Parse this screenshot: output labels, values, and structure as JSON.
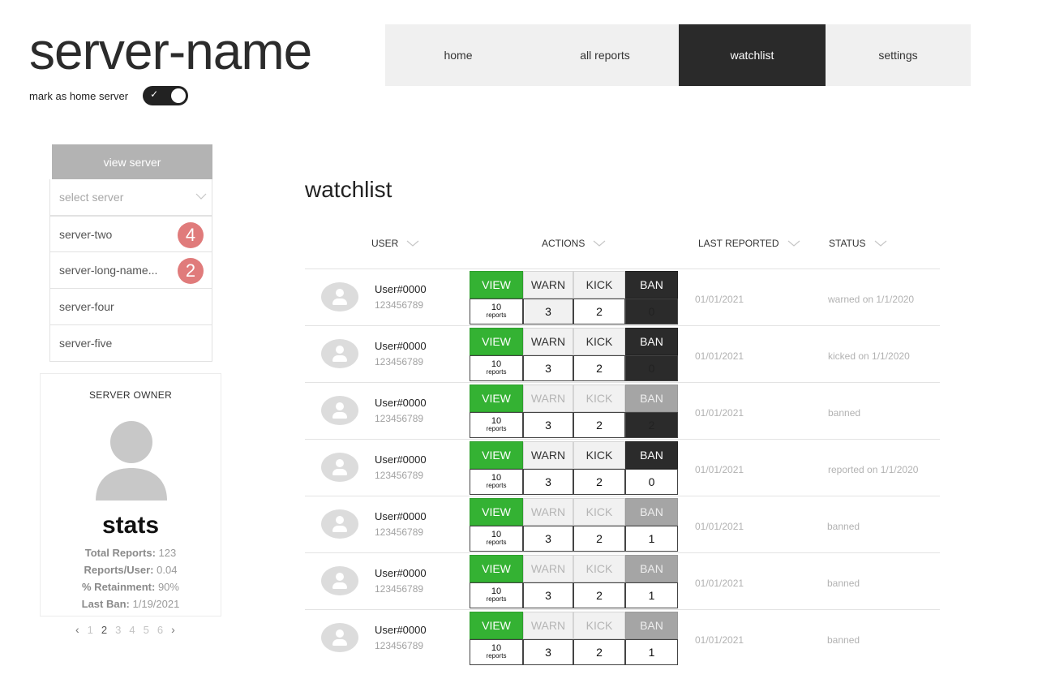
{
  "header": {
    "server_name": "server-name",
    "home_toggle_label": "mark as home server",
    "home_toggle_on": true
  },
  "nav": {
    "tabs": [
      {
        "label": "home",
        "active": false
      },
      {
        "label": "all reports",
        "active": false
      },
      {
        "label": "watchlist",
        "active": true
      },
      {
        "label": "settings",
        "active": false
      }
    ]
  },
  "sidebar": {
    "view_server_label": "view server",
    "select_placeholder": "select server",
    "servers": [
      {
        "name": "server-two",
        "badge": "4"
      },
      {
        "name": "server-long-name...",
        "badge": "2"
      },
      {
        "name": "server-four",
        "badge": ""
      },
      {
        "name": "server-five",
        "badge": ""
      }
    ],
    "owner_card": {
      "title": "SERVER OWNER",
      "stats_title": "stats",
      "stats": [
        {
          "label": "Total Reports:",
          "value": "123"
        },
        {
          "label": "Reports/User:",
          "value": "0.04"
        },
        {
          "label": "% Retainment:",
          "value": "90%"
        },
        {
          "label": "Last Ban:",
          "value": "1/19/2021"
        }
      ]
    },
    "pagination": {
      "prev": "‹",
      "next": "›",
      "pages": [
        "1",
        "2",
        "3",
        "4",
        "5",
        "6"
      ],
      "current": "2"
    }
  },
  "main": {
    "heading": "watchlist",
    "columns": [
      "USER",
      "ACTIONS",
      "LAST REPORTED",
      "STATUS"
    ],
    "action_labels": {
      "view": "VIEW",
      "warn": "WARN",
      "kick": "KICK",
      "ban": "BAN"
    },
    "reports_unit": "reports",
    "rows": [
      {
        "user": "User#0000",
        "id": "123456789",
        "reports": "10",
        "warns": "3",
        "kicks": "2",
        "bans": "0",
        "last_reported": "01/01/2021",
        "status": "warned on 1/1/2020",
        "muted": false,
        "ban_dark": true,
        "warn_shaded": true
      },
      {
        "user": "User#0000",
        "id": "123456789",
        "reports": "10",
        "warns": "3",
        "kicks": "2",
        "bans": "0",
        "last_reported": "01/01/2021",
        "status": "kicked on 1/1/2020",
        "muted": false,
        "ban_dark": true,
        "warn_shaded": false
      },
      {
        "user": "User#0000",
        "id": "123456789",
        "reports": "10",
        "warns": "3",
        "kicks": "2",
        "bans": "2",
        "last_reported": "01/01/2021",
        "status": "banned",
        "muted": true,
        "ban_dark": true,
        "warn_shaded": false
      },
      {
        "user": "User#0000",
        "id": "123456789",
        "reports": "10",
        "warns": "3",
        "kicks": "2",
        "bans": "0",
        "last_reported": "01/01/2021",
        "status": "reported on 1/1/2020",
        "muted": false,
        "ban_dark": false,
        "warn_shaded": false
      },
      {
        "user": "User#0000",
        "id": "123456789",
        "reports": "10",
        "warns": "3",
        "kicks": "2",
        "bans": "1",
        "last_reported": "01/01/2021",
        "status": "banned",
        "muted": true,
        "ban_dark": false,
        "warn_shaded": false
      },
      {
        "user": "User#0000",
        "id": "123456789",
        "reports": "10",
        "warns": "3",
        "kicks": "2",
        "bans": "1",
        "last_reported": "01/01/2021",
        "status": "banned",
        "muted": true,
        "ban_dark": false,
        "warn_shaded": false
      },
      {
        "user": "User#0000",
        "id": "123456789",
        "reports": "10",
        "warns": "3",
        "kicks": "2",
        "bans": "1",
        "last_reported": "01/01/2021",
        "status": "banned",
        "muted": true,
        "ban_dark": false,
        "warn_shaded": false
      }
    ]
  },
  "colors": {
    "view_green": "#34b233",
    "nav_active": "#2a2a2a",
    "badge_red": "#e07b7b"
  }
}
